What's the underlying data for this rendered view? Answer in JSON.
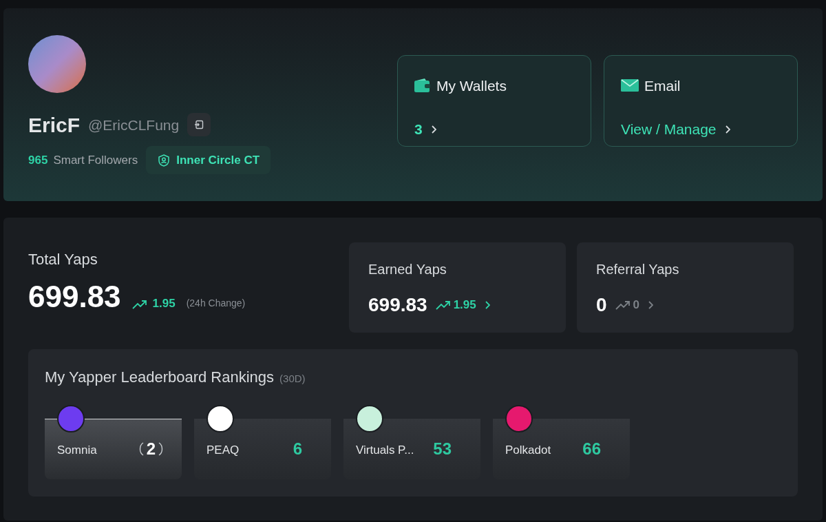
{
  "profile": {
    "name": "EricF",
    "handle": "@EricCLFung",
    "smart_followers_count": "965",
    "smart_followers_label": "Smart Followers",
    "badge": "Inner Circle CT"
  },
  "cards": [
    {
      "kind": "wallet",
      "title": "My Wallets",
      "value": "3"
    },
    {
      "kind": "email",
      "title": "Email",
      "value": "View / Manage"
    }
  ],
  "total_yaps": {
    "label": "Total Yaps",
    "value": "699.83",
    "change": "1.95",
    "change_note": "(24h Change)"
  },
  "yap_cards": [
    {
      "label": "Earned Yaps",
      "value": "699.83",
      "change": "1.95",
      "positive": true
    },
    {
      "label": "Referral Yaps",
      "value": "0",
      "change": "0",
      "positive": false
    }
  ],
  "rankings": {
    "title": "My Yapper Leaderboard Rankings",
    "period": "(30D)",
    "items": [
      {
        "name": "Somnia",
        "rank": "2",
        "kind": "podium",
        "color": "#6d3cf0"
      },
      {
        "name": "PEAQ",
        "rank": "6",
        "kind": "plain",
        "color": "#ffffff"
      },
      {
        "name": "Virtuals P...",
        "rank": "53",
        "kind": "plain",
        "color": "#c8f0dc"
      },
      {
        "name": "Polkadot",
        "rank": "66",
        "kind": "plain",
        "color": "#e6196e"
      }
    ]
  }
}
